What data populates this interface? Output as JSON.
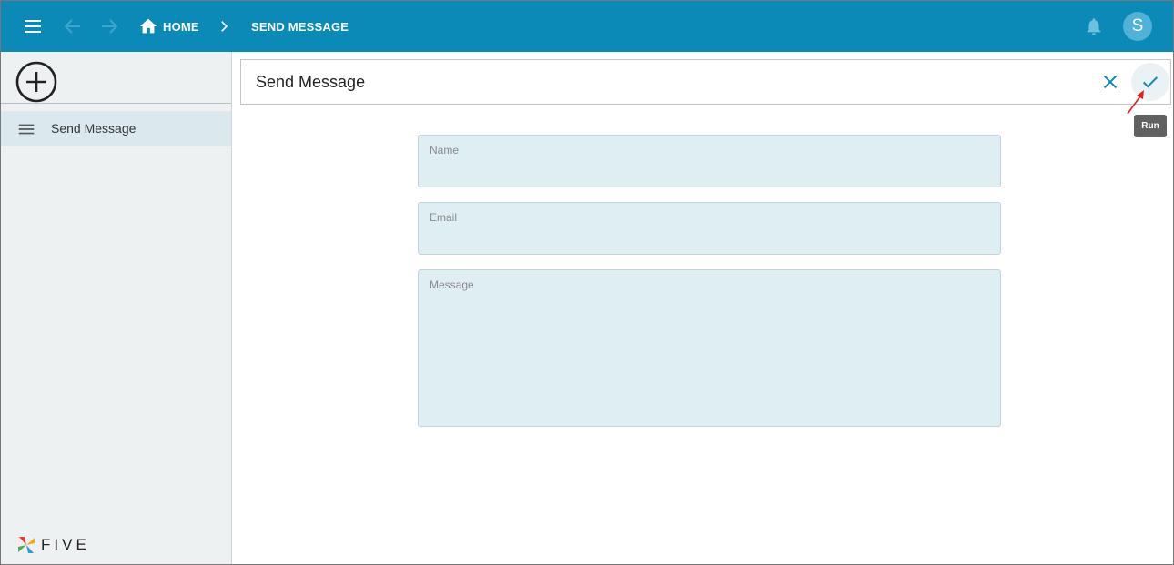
{
  "topbar": {
    "breadcrumb_home": "HOME",
    "breadcrumb_current": "SEND MESSAGE",
    "avatar_letter": "S",
    "color": "#0b89b7"
  },
  "sidebar": {
    "items": [
      {
        "label": "Send Message",
        "icon": "list-icon"
      }
    ],
    "logo_text": "FIVE"
  },
  "form": {
    "title": "Send Message",
    "fields": {
      "name": {
        "label": "Name",
        "value": ""
      },
      "email": {
        "label": "Email",
        "value": ""
      },
      "message": {
        "label": "Message",
        "value": ""
      }
    },
    "tooltip": "Run",
    "accent": "#0b89b7"
  }
}
